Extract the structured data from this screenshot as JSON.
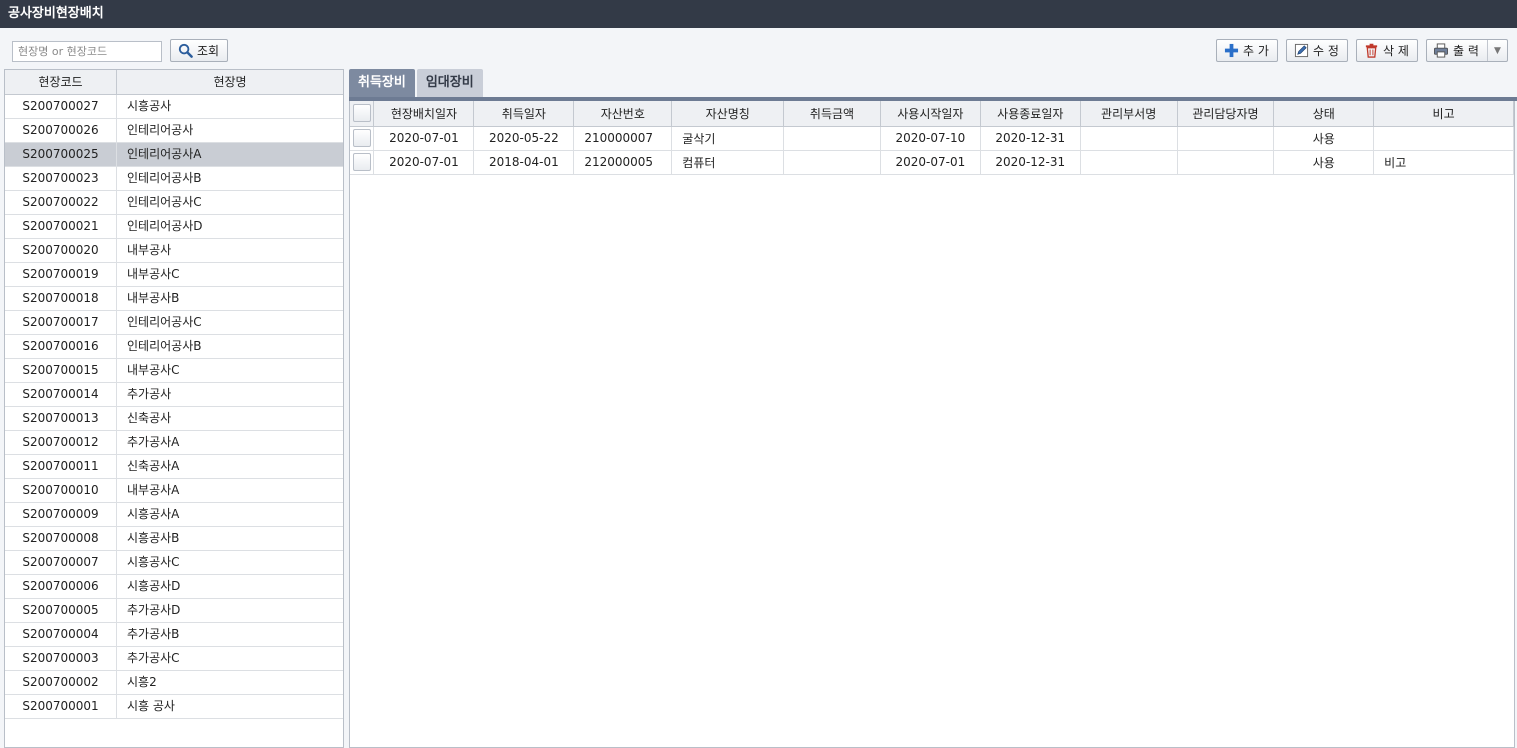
{
  "app": {
    "title": "공사장비현장배치"
  },
  "search": {
    "placeholder": "현장명 or 현장코드",
    "button_label": "조회"
  },
  "toolbar": {
    "add_label": "추 가",
    "edit_label": "수 정",
    "delete_label": "삭 제",
    "print_label": "출 력"
  },
  "sites": {
    "columns": [
      "현장코드",
      "현장명"
    ],
    "selected_index": 2,
    "rows": [
      {
        "code": "S200700027",
        "name": "시흥공사"
      },
      {
        "code": "S200700026",
        "name": "인테리어공사"
      },
      {
        "code": "S200700025",
        "name": "인테리어공사A"
      },
      {
        "code": "S200700023",
        "name": "인테리어공사B"
      },
      {
        "code": "S200700022",
        "name": "인테리어공사C"
      },
      {
        "code": "S200700021",
        "name": "인테리어공사D"
      },
      {
        "code": "S200700020",
        "name": "내부공사"
      },
      {
        "code": "S200700019",
        "name": "내부공사C"
      },
      {
        "code": "S200700018",
        "name": "내부공사B"
      },
      {
        "code": "S200700017",
        "name": "인테리어공사C"
      },
      {
        "code": "S200700016",
        "name": "인테리어공사B"
      },
      {
        "code": "S200700015",
        "name": "내부공사C"
      },
      {
        "code": "S200700014",
        "name": "추가공사"
      },
      {
        "code": "S200700013",
        "name": "신축공사"
      },
      {
        "code": "S200700012",
        "name": "추가공사A"
      },
      {
        "code": "S200700011",
        "name": "신축공사A"
      },
      {
        "code": "S200700010",
        "name": "내부공사A"
      },
      {
        "code": "S200700009",
        "name": "시흥공사A"
      },
      {
        "code": "S200700008",
        "name": "시흥공사B"
      },
      {
        "code": "S200700007",
        "name": "시흥공사C"
      },
      {
        "code": "S200700006",
        "name": "시흥공사D"
      },
      {
        "code": "S200700005",
        "name": "추가공사D"
      },
      {
        "code": "S200700004",
        "name": "추가공사B"
      },
      {
        "code": "S200700003",
        "name": "추가공사C"
      },
      {
        "code": "S200700002",
        "name": "시흥2"
      },
      {
        "code": "S200700001",
        "name": "시흥 공사"
      }
    ]
  },
  "tabs": [
    {
      "label": "취득장비",
      "active": true
    },
    {
      "label": "임대장비",
      "active": false
    }
  ],
  "equipment": {
    "columns": [
      "현장배치일자",
      "취득일자",
      "자산번호",
      "자산명칭",
      "취득금액",
      "사용시작일자",
      "사용종료일자",
      "관리부서명",
      "관리담당자명",
      "상태",
      "비고"
    ],
    "rows": [
      [
        "2020-07-01",
        "2020-05-22",
        "210000007",
        "굴삭기",
        "",
        "2020-07-10",
        "2020-12-31",
        "",
        "",
        "사용",
        ""
      ],
      [
        "2020-07-01",
        "2018-04-01",
        "212000005",
        "컴퓨터",
        "",
        "2020-07-01",
        "2020-12-31",
        "",
        "",
        "사용",
        "비고"
      ]
    ]
  },
  "icons": {
    "search": "magnifier-icon",
    "add": "plus-icon",
    "edit": "pencil-icon",
    "delete": "trash-icon",
    "print": "printer-icon",
    "dropdown": "caret-down-icon"
  },
  "colors": {
    "titlebar": "#333a47",
    "tab_active": "#7d8aa0",
    "selected_row": "#c9cdd4",
    "plus": "#2a6fc9",
    "trash": "#c0392b"
  }
}
